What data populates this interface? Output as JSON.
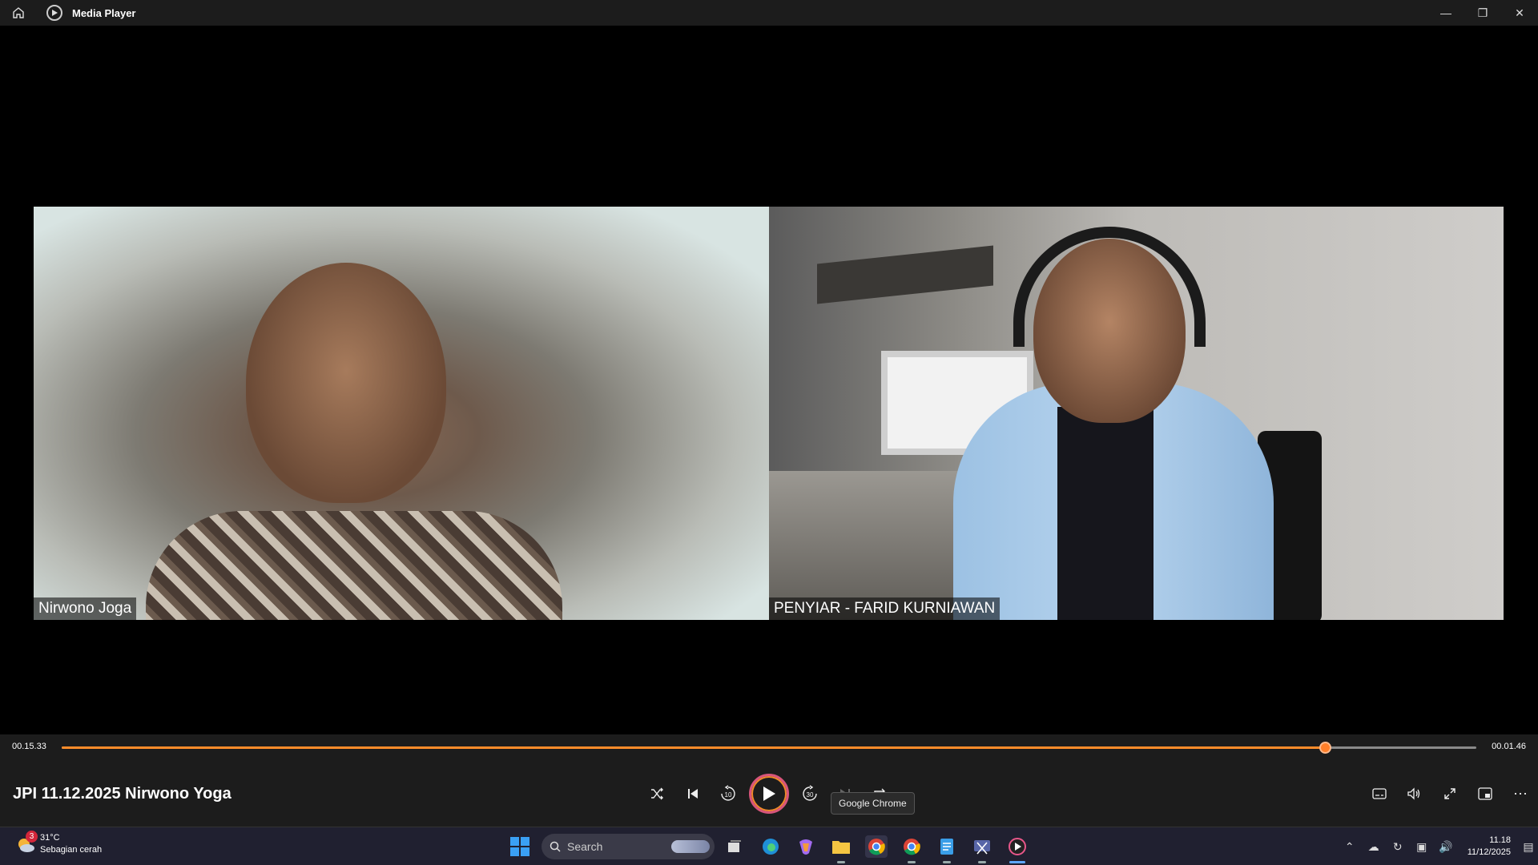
{
  "window": {
    "title": "Media Player",
    "icons": {
      "home": "home-icon",
      "app": "media-player-icon",
      "minimize": "minimize-icon",
      "maximize": "restore-icon",
      "close": "close-icon"
    }
  },
  "video": {
    "participants": [
      {
        "name": "Nirwono Joga"
      },
      {
        "name": "PENYIAR - FARID KURNIAWAN"
      }
    ]
  },
  "player": {
    "current_time": "00.15.33",
    "total_time": "00.01.46",
    "progress": 0.893,
    "accent_color": "#ff8c2a",
    "track_title": "JPI 11.12.2025 Nirwono Yoga",
    "rewind_label": "10",
    "forward_label": "30",
    "tooltip": "Google Chrome"
  },
  "taskbar": {
    "weather": {
      "badge": "3",
      "temp": "31°C",
      "condition": "Sebagian cerah"
    },
    "search_placeholder": "Search",
    "clock": {
      "time": "11.18",
      "date": "11/12/2025"
    }
  }
}
